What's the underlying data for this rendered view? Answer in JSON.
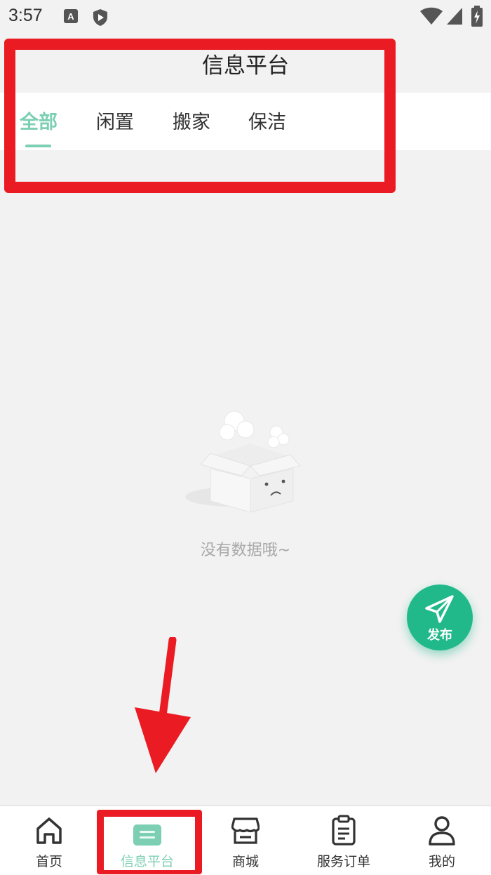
{
  "status_bar": {
    "time": "3:57"
  },
  "header": {
    "title": "信息平台"
  },
  "tabs": [
    {
      "label": "全部",
      "active": true
    },
    {
      "label": "闲置",
      "active": false
    },
    {
      "label": "搬家",
      "active": false
    },
    {
      "label": "保洁",
      "active": false
    }
  ],
  "empty_state": {
    "text": "没有数据哦~"
  },
  "fab": {
    "label": "发布",
    "icon": "paper-plane-icon"
  },
  "bottom_nav": [
    {
      "label": "首页",
      "icon": "home-icon",
      "active": false
    },
    {
      "label": "信息平台",
      "icon": "info-platform-icon",
      "active": true
    },
    {
      "label": "商城",
      "icon": "store-icon",
      "active": false
    },
    {
      "label": "服务订单",
      "icon": "clipboard-icon",
      "active": false
    },
    {
      "label": "我的",
      "icon": "user-icon",
      "active": false
    }
  ],
  "colors": {
    "accent": "#7ccfb3",
    "fab": "#22b98a",
    "annotation": "#ea1b23",
    "background": "#f2f2f2"
  }
}
